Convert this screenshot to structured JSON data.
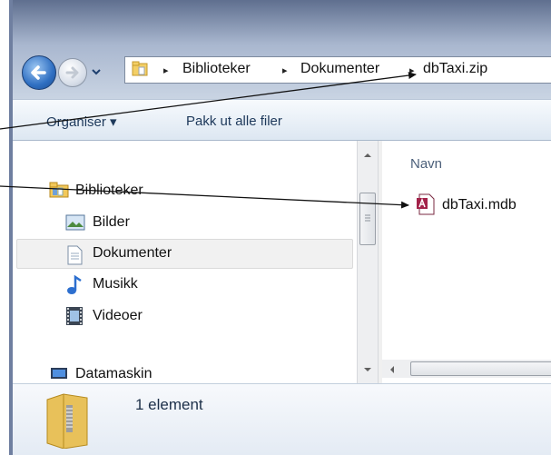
{
  "addressbar": {
    "crumbs": [
      "Biblioteker",
      "Dokumenter",
      "dbTaxi.zip"
    ],
    "separator": "▸"
  },
  "toolbar": {
    "organise_label": "Organiser ▾",
    "extract_label": "Pakk ut alle filer"
  },
  "navpane": {
    "items": [
      {
        "label": "Biblioteker",
        "icon": "libraries-icon"
      },
      {
        "label": "Bilder",
        "icon": "pictures-icon"
      },
      {
        "label": "Dokumenter",
        "icon": "documents-icon",
        "selected": true
      },
      {
        "label": "Musikk",
        "icon": "music-icon"
      },
      {
        "label": "Videoer",
        "icon": "videos-icon"
      },
      {
        "label": "Datamaskin",
        "icon": "computer-icon"
      }
    ]
  },
  "filepane": {
    "column_header": "Navn",
    "files": [
      {
        "name": "dbTaxi.mdb",
        "icon": "access-database-icon"
      }
    ]
  },
  "details": {
    "item_count": "1 element",
    "icon": "zip-folder-icon"
  },
  "colors": {
    "accent": "#2f6fc2",
    "toolbar_text": "#1e395b",
    "annotation_line": "#111111"
  }
}
